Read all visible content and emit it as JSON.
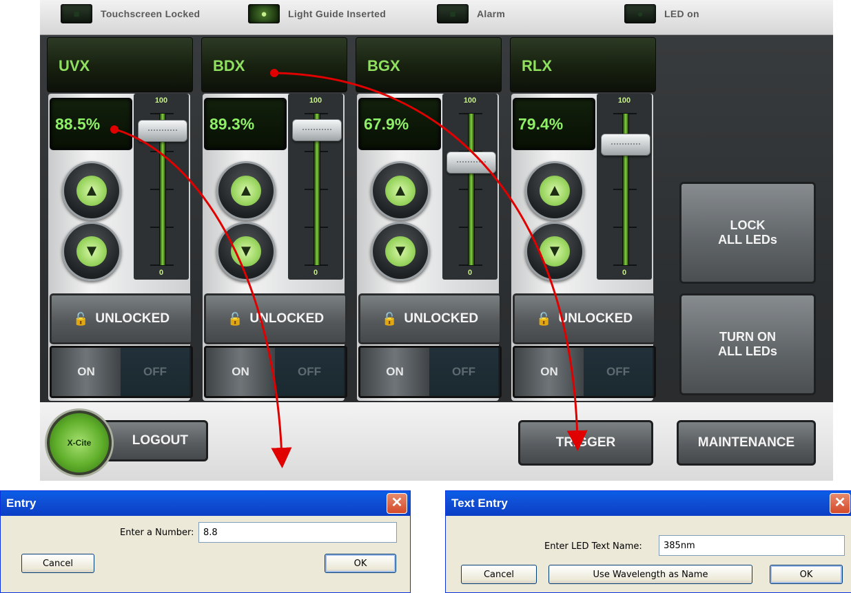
{
  "status": {
    "indicators": [
      {
        "label": "Touchscreen Locked",
        "icon": "lock-icon",
        "on": false
      },
      {
        "label": "Light Guide Inserted",
        "icon": "bulb-icon",
        "on": true
      },
      {
        "label": "Alarm",
        "icon": "alarm-icon",
        "on": false
      },
      {
        "label": "LED on",
        "icon": "led-icon",
        "on": false
      }
    ]
  },
  "channels": [
    {
      "name": "UVX",
      "intensity": "88.5%",
      "level": 88.5,
      "lock_label": "UNLOCKED",
      "on_label": "ON",
      "off_label": "OFF"
    },
    {
      "name": "BDX",
      "intensity": "89.3%",
      "level": 89.3,
      "lock_label": "UNLOCKED",
      "on_label": "ON",
      "off_label": "OFF"
    },
    {
      "name": "BGX",
      "intensity": "67.9%",
      "level": 67.9,
      "lock_label": "UNLOCKED",
      "on_label": "ON",
      "off_label": "OFF"
    },
    {
      "name": "RLX",
      "intensity": "79.4%",
      "level": 79.4,
      "lock_label": "UNLOCKED",
      "on_label": "ON",
      "off_label": "OFF"
    }
  ],
  "slider_scale": {
    "max": "100",
    "min": "0"
  },
  "side_buttons": {
    "lock_all": "LOCK\nALL LEDs",
    "turn_on_all": "TURN ON\nALL LEDs"
  },
  "bottom": {
    "logo": "X-Cite",
    "logout": "LOGOUT",
    "trigger": "TRIGGER",
    "maintenance": "MAINTENANCE"
  },
  "entry_dialog": {
    "title": "Entry",
    "label": "Enter a Number:",
    "value": "8.8",
    "cancel": "Cancel",
    "ok": "OK"
  },
  "text_entry_dialog": {
    "title": "Text Entry",
    "label": "Enter LED Text Name:",
    "value": "385nm",
    "cancel": "Cancel",
    "use_wavelength": "Use Wavelength as Name",
    "ok": "OK"
  },
  "colors": {
    "accent_green": "#8ff068",
    "arrow_red": "#e00000",
    "xp_title_blue": "#0a5ee8"
  }
}
